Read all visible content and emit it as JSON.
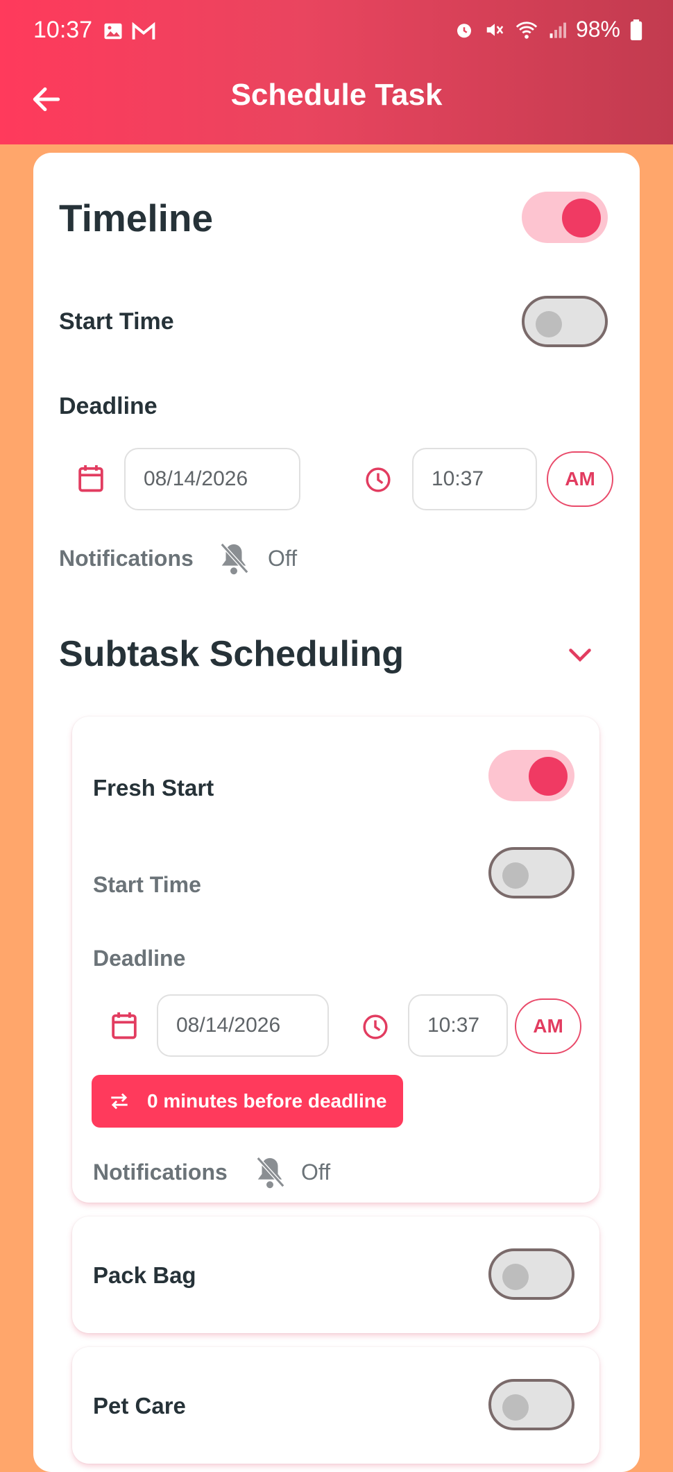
{
  "status_bar": {
    "time": "10:37",
    "battery": "98%"
  },
  "header": {
    "title": "Schedule Task"
  },
  "timeline": {
    "heading": "Timeline",
    "start_time_label": "Start Time",
    "deadline_label": "Deadline",
    "date": "08/14/2026",
    "time": "10:37",
    "ampm": "AM",
    "notifications_label": "Notifications",
    "notifications_value": "Off"
  },
  "subtask_scheduling": {
    "heading": "Subtask Scheduling",
    "subtasks": [
      {
        "name": "Fresh Start",
        "start_time_label": "Start Time",
        "deadline_label": "Deadline",
        "date": "08/14/2026",
        "time": "10:37",
        "ampm": "AM",
        "offset": "0 minutes before deadline",
        "notifications_label": "Notifications",
        "notifications_value": "Off"
      },
      {
        "name": "Pack Bag"
      },
      {
        "name": "Pet Care"
      }
    ]
  },
  "colors": {
    "accent": "#F03A63",
    "background": "#FFA66B",
    "header_start": "#FF3A5C",
    "header_end": "#C23B4F"
  },
  "icons": [
    "back-arrow-icon",
    "calendar-icon",
    "clock-icon",
    "bell-off-icon",
    "chevron-down-icon",
    "swap-icon"
  ]
}
